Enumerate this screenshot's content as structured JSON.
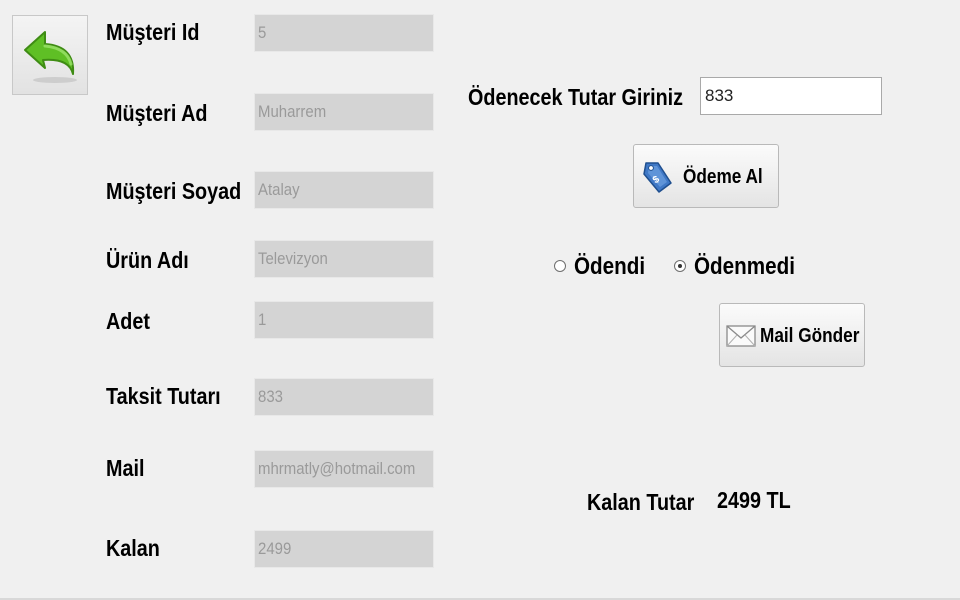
{
  "back_button": {
    "icon": "back-arrow-icon",
    "color": "#43a317"
  },
  "customer_form": {
    "fields": [
      {
        "label": "Müşteri Id",
        "value": "5"
      },
      {
        "label": "Müşteri Ad",
        "value": "Muharrem"
      },
      {
        "label": "Müşteri Soyad",
        "value": "Atalay"
      },
      {
        "label": "Ürün Adı",
        "value": "Televizyon"
      },
      {
        "label": "Adet",
        "value": "1"
      },
      {
        "label": "Taksit Tutarı",
        "value": "833"
      },
      {
        "label": "Mail",
        "value": "mhrmatly@hotmail.com"
      },
      {
        "label": "Kalan",
        "value": "2499"
      }
    ]
  },
  "payment": {
    "amount_label": "Ödenecek Tutar Giriniz",
    "amount_value": "833",
    "pay_button_label": "Ödeme Al",
    "pay_button_icon": "price-tag-icon",
    "radio_paid_label": "Ödendi",
    "radio_unpaid_label": "Ödenmedi",
    "selected_status": "Ödenmedi",
    "mail_button_label": "Mail Gönder",
    "mail_button_icon": "envelope-icon",
    "remaining_label": "Kalan Tutar",
    "remaining_value": "2499 TL"
  }
}
